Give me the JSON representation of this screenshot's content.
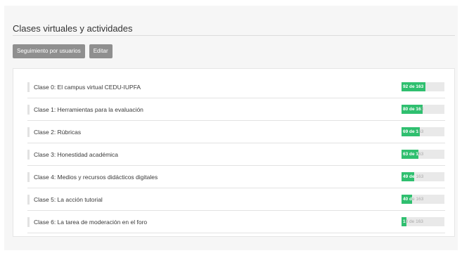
{
  "page": {
    "title": "Clases virtuales y actividades"
  },
  "toolbar": {
    "tracking_label": "Seguimiento por usuarios",
    "edit_label": "Editar"
  },
  "progress_color": "#2fbf6f",
  "classes": [
    {
      "label": "Clase 0: El campus virtual CEDU-IUPFA",
      "done": 92,
      "total": 163,
      "progress_text": "92 de 163"
    },
    {
      "label": "Clase 1: Herramientas para la evaluación",
      "done": 80,
      "total": 163,
      "progress_text": "80 de 163"
    },
    {
      "label": "Clase 2: Rúbricas",
      "done": 69,
      "total": 163,
      "progress_text": "69 de 163"
    },
    {
      "label": "Clase 3: Honestidad académica",
      "done": 63,
      "total": 163,
      "progress_text": "63 de 163"
    },
    {
      "label": "Clase 4: Medios y recursos didácticos digitales",
      "done": 49,
      "total": 163,
      "progress_text": "49 de 163"
    },
    {
      "label": "Clase 5: La acción tutorial",
      "done": 40,
      "total": 163,
      "progress_text": "40 de 163"
    },
    {
      "label": "Clase 6: La tarea de moderación en el foro",
      "done": 18,
      "total": 163,
      "progress_text": "18 de 163"
    }
  ]
}
